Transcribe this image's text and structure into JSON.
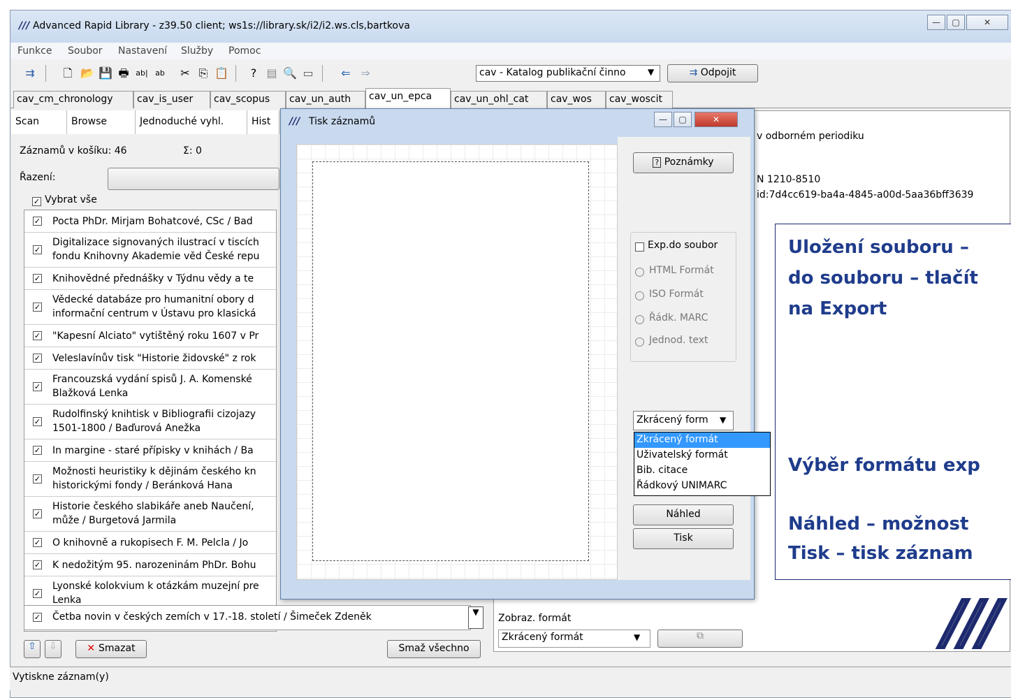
{
  "window": {
    "title": "Advanced Rapid Library - z39.50 client; ws1s://library.sk/i2/i2.ws.cls,bartkova",
    "logo": "///",
    "buttons": [
      "—",
      "▢",
      "✕"
    ]
  },
  "menu": [
    "Funkce",
    "Soubor",
    "Nastavení",
    "Služby",
    "Pomoc"
  ],
  "toolbar": {
    "catalog": "cav - Katalog publikační činno",
    "disconnect": "Odpojit"
  },
  "tabs": [
    "cav_cm_chronology",
    "cav_is_user",
    "cav_scopus",
    "cav_un_auth",
    "cav_un_epca",
    "cav_un_ohl_cat",
    "cav_wos",
    "cav_woscit"
  ],
  "active_tab": "cav_un_epca",
  "subtabs": [
    "Scan",
    "Browse",
    "Jednoduché vyhl.",
    "Hist"
  ],
  "basket": {
    "count_label": "Záznamů v košíku: 46",
    "sum_label": "Σ: 0",
    "sort_label": "Řazení:",
    "select_all": "Vybrat vše"
  },
  "records": [
    [
      "Pocta PhDr. Mirjam Bohatcové, CSc / Bad"
    ],
    [
      "Digitalizace signovaných ilustrací v tiscích",
      "fondu Knihovny Akademie věd České repu"
    ],
    [
      "Knihovědné přednášky v Týdnu vědy a te"
    ],
    [
      "Vědecké databáze pro humanitní obory d",
      "informační centrum v Ústavu pro klasická"
    ],
    [
      "\"Kapesní Alciato\" vytištěný roku 1607 v Pr"
    ],
    [
      "Veleslavínův tisk \"Historie židovské\" z rok"
    ],
    [
      "Francouzská vydání spisů J. A. Komenské",
      "Blažková Lenka"
    ],
    [
      "Rudolfinský knihtisk v Bibliografii cizojazy",
      "1501-1800 / Baďurová Anežka"
    ],
    [
      "In margine - staré přípisky v knihách / Ba"
    ],
    [
      "Možnosti heuristiky k dějinám českého kn",
      "historickými fondy / Beránková Hana"
    ],
    [
      "Historie českého slabikáře aneb Naučení,",
      "může / Burgetová Jarmila"
    ],
    [
      "O knihovně a rukopisech F. M. Pelcla / Jo"
    ],
    [
      "K nedožitým 95. narozeninám PhDr. Bohu"
    ],
    [
      "Lyonské kolokvium k otázkám muzejní pre",
      "Lenka"
    ],
    [
      "Četba novin v českých zemích v 17.-18. století / Šimeček Zdeněk"
    ]
  ],
  "bottom": {
    "delete": "Smazat",
    "delete_all": "Smaž všechno"
  },
  "status": "Vytiskne záznam(y)",
  "detail": {
    "line1": "v odborném periodiku",
    "line2": "N 1210-8510",
    "line3": "id:7d4cc619-ba4a-4845-a00d-5aa36bff3639",
    "format_label": "Zobraz. formát",
    "format_value": "Zkrácený formát"
  },
  "dialog": {
    "title": "Tisk záznamů",
    "notes": "Poznámky",
    "export_to_file": "Exp.do soubor",
    "formats": [
      "HTML Formát",
      "ISO Formát",
      "Řádk. MARC",
      "Jednod. text"
    ],
    "selected_format": "HTML Formát",
    "combo_value": "Zkrácený form",
    "dropdown": [
      "Zkrácený formát",
      "Uživatelský formát",
      "Bib. citace",
      "Řádkový UNIMARC"
    ],
    "dropdown_selected": "Zkrácený formát",
    "preview": "Náhled",
    "print": "Tisk"
  },
  "annotation": {
    "line1": "Uložení souboru –",
    "line2": "do souboru – tlačít",
    "line3": "na Export",
    "line4": "Výběr formátu exp",
    "line5": "Náhled – možnost",
    "line6": "Tisk – tisk záznam"
  }
}
